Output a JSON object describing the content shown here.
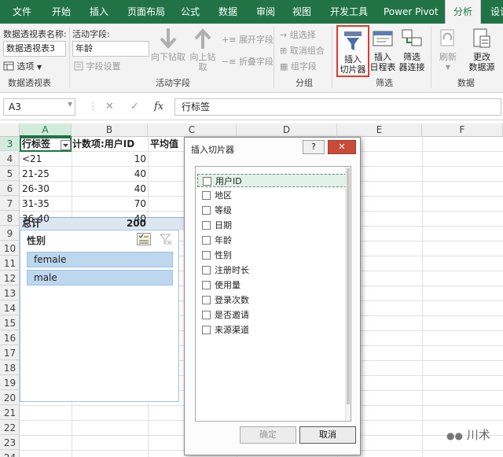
{
  "ribbon_tabs": [
    "文件",
    "开始",
    "插入",
    "页面布局",
    "公式",
    "数据",
    "审阅",
    "视图",
    "开发工具",
    "Power Pivot",
    "分析",
    "设计"
  ],
  "active_tab": "分析",
  "pivot_group": {
    "name_label": "数据透视表名称:",
    "name_value": "数据透视表3",
    "options_label": "选项",
    "group_label": "数据透视表"
  },
  "active_field_group": {
    "label": "活动字段:",
    "value": "年龄",
    "field_settings": "字段设置",
    "drill_down": "向下钻取",
    "drill_up_1": "向上钻",
    "drill_up_2": "取",
    "expand_field": "展开字段",
    "collapse_field": "折叠字段",
    "group_label": "活动字段"
  },
  "group_group": {
    "group_selection": "组选择",
    "ungroup": "取消组合",
    "group_field": "组字段",
    "group_label": "分组"
  },
  "filter_group": {
    "insert_slicer_1": "插入",
    "insert_slicer_2": "切片器",
    "insert_timeline_1": "插入",
    "insert_timeline_2": "日程表",
    "filter_connections_1": "筛选",
    "filter_connections_2": "器连接",
    "group_label": "筛选"
  },
  "data_group": {
    "refresh": "刷新",
    "change_source_1": "更改",
    "change_source_2": "数据源",
    "group_label": "数据"
  },
  "formula_bar": {
    "name_box": "A3",
    "content": "行标签",
    "cancel_glyph": "✕",
    "enter_glyph": "✓",
    "fx_glyph": "fx"
  },
  "columns": [
    "A",
    "B",
    "C",
    "D",
    "E",
    "F"
  ],
  "rows": [
    "3",
    "4",
    "5",
    "6",
    "7",
    "8",
    "9",
    "10",
    "11",
    "12",
    "13",
    "14",
    "15",
    "16",
    "17",
    "18",
    "19",
    "20",
    "21",
    "22",
    "23",
    "24"
  ],
  "pivot": {
    "row_label_header": "行标签",
    "count_header": "计数项:用户ID",
    "avg_header": "平均值",
    "rows": [
      {
        "label": "<21",
        "value": "10"
      },
      {
        "label": "21-25",
        "value": "40"
      },
      {
        "label": "26-30",
        "value": "40"
      },
      {
        "label": "31-35",
        "value": "70"
      },
      {
        "label": "36-40",
        "value": "40"
      }
    ],
    "total_label": "总计",
    "total_value": "200"
  },
  "slicer": {
    "title": "性别",
    "items": [
      "female",
      "male"
    ]
  },
  "dialog": {
    "title": "插入切片器",
    "help_label": "?",
    "close_glyph": "✕",
    "fields": [
      "用户ID",
      "地区",
      "等级",
      "日期",
      "年龄",
      "性别",
      "注册时长",
      "使用量",
      "登录次数",
      "是否邀请",
      "来源渠道"
    ],
    "ok_label": "确定",
    "cancel_label": "取消"
  },
  "watermark": "川术",
  "colors": {
    "excel_green": "#217346",
    "slicer_item": "#bdd7ee",
    "total_row": "#dde7f3",
    "highlight_border": "#e0392b"
  }
}
